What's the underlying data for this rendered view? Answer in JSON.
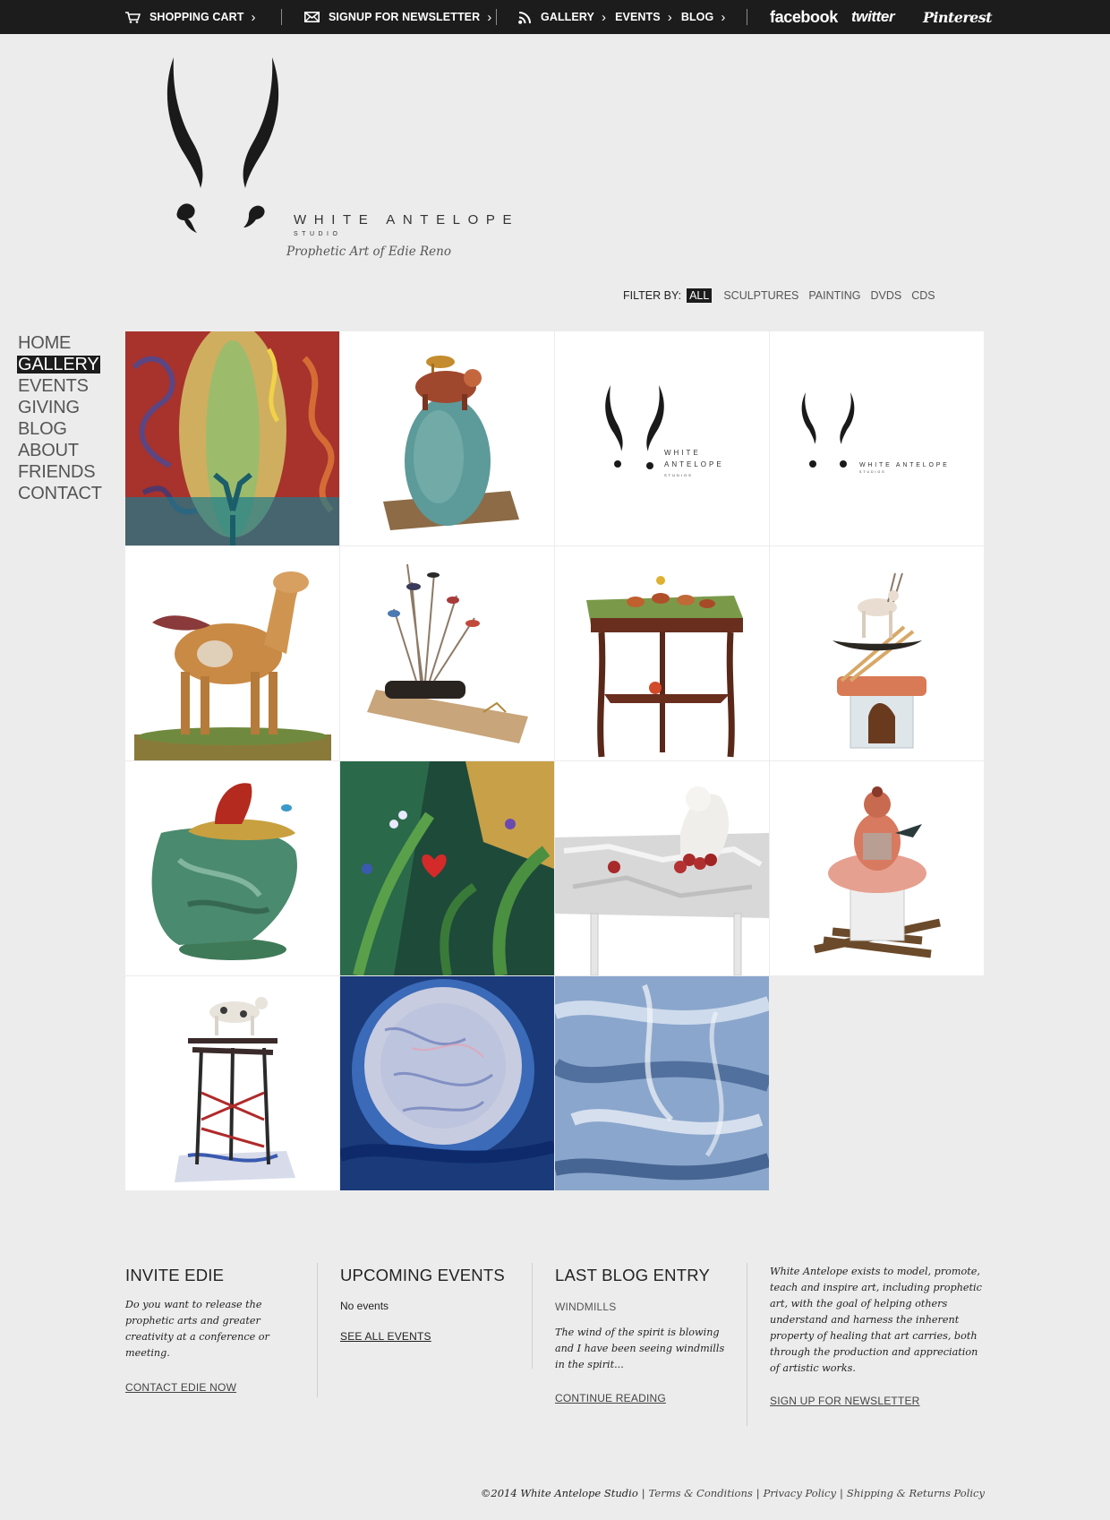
{
  "topbar": {
    "cart_label": "SHOPPING CART",
    "newsletter_label": "SIGNUP FOR NEWSLETTER",
    "gallery_label": "GALLERY",
    "events_label": "EVENTS",
    "blog_label": "BLOG",
    "facebook_label": "facebook",
    "twitter_label": "twitter",
    "pinterest_label": "Pinterest",
    "icons": [
      "cart-icon",
      "envelope-icon",
      "rss-icon",
      "chevron-right-icon"
    ]
  },
  "brand": {
    "wordmark": "WHITE ANTELOPE",
    "sub": "STUDIO",
    "tagline": "Prophetic Art of Edie Reno"
  },
  "filter": {
    "label": "FILTER BY:",
    "options": [
      "ALL",
      "SCULPTURES",
      "PAINTING",
      "DVDS",
      "CDS"
    ],
    "selected": "ALL"
  },
  "nav": {
    "items": [
      "HOME",
      "GALLERY",
      "EVENTS",
      "GIVING",
      "BLOG",
      "ABOUT",
      "FRIENDS",
      "CONTACT"
    ],
    "active": "GALLERY"
  },
  "gallery": {
    "count": 15,
    "logo_tile_wordmark": "WHITE ANTELOPE",
    "logo_tile_sub": "STUDIOS"
  },
  "footer": {
    "invite": {
      "title": "INVITE EDIE",
      "text": "Do you want to release the prophetic arts and greater creativity at a conference or meeting.",
      "link": "CONTACT EDIE NOW"
    },
    "events": {
      "title": "UPCOMING EVENTS",
      "empty": "No events",
      "link": "SEE ALL EVENTS"
    },
    "blog": {
      "title": "LAST BLOG ENTRY",
      "entry_title": "WINDMILLS",
      "excerpt": "The wind of the spirit is blowing and I have been seeing windmills in the spirit...",
      "link": "CONTINUE READING"
    },
    "about": {
      "text": "White Antelope exists to model, promote, teach and inspire art, including prophetic art, with the goal of helping others understand and harness the inherent property of healing that art carries, both through the production and appreciation of artistic works.",
      "link": "SIGN UP FOR NEWSLETTER"
    },
    "copyright": "©2014 White Antelope Studio",
    "links": [
      "Terms & Conditions",
      "Privacy Policy",
      "Shipping & Returns Policy"
    ]
  },
  "colors": {
    "topbar_bg": "#1c1c1c",
    "page_bg": "#ececec",
    "active_bg": "#1c1c1c",
    "nav_text": "#555555"
  }
}
